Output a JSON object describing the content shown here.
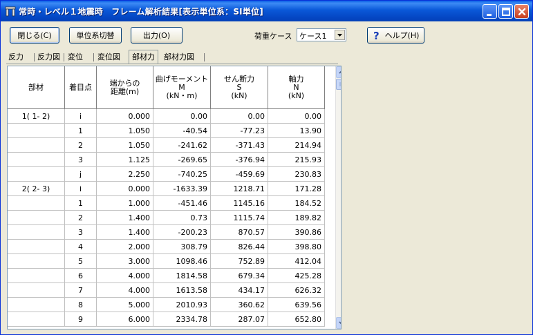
{
  "window": {
    "title": "常時・レベル１地震時　フレーム解析結果[表示単位系：SI単位]"
  },
  "toolbar": {
    "close_label": "閉じる(C)",
    "unit_label": "単位系切替",
    "output_label": "出力(O)",
    "load_case_label": "荷重ケース",
    "load_case_value": "ケース1",
    "help_label": "ヘルプ(H)"
  },
  "tabs": [
    "反力",
    "反力図",
    "変位",
    "変位図",
    "部材力",
    "部材力図"
  ],
  "active_tab": "部材力",
  "table": {
    "headers": [
      [
        "部材"
      ],
      [
        "着目点"
      ],
      [
        "端からの",
        "距離(m)"
      ],
      [
        "曲げモーメント",
        "M",
        "(kN・m)"
      ],
      [
        "せん断力",
        "S",
        "(kN)"
      ],
      [
        "軸力",
        "N",
        "(kN)"
      ]
    ],
    "rows": [
      [
        "1( 1- 2)",
        "i",
        "0.000",
        "0.00",
        "0.00",
        "0.00"
      ],
      [
        "",
        "1",
        "1.050",
        "-40.54",
        "-77.23",
        "13.90"
      ],
      [
        "",
        "2",
        "1.050",
        "-241.62",
        "-371.43",
        "214.94"
      ],
      [
        "",
        "3",
        "1.125",
        "-269.65",
        "-376.94",
        "215.93"
      ],
      [
        "",
        "j",
        "2.250",
        "-740.25",
        "-459.69",
        "230.83"
      ],
      [
        "2( 2- 3)",
        "i",
        "0.000",
        "-1633.39",
        "1218.71",
        "171.28"
      ],
      [
        "",
        "1",
        "1.000",
        "-451.46",
        "1145.16",
        "184.52"
      ],
      [
        "",
        "2",
        "1.400",
        "0.73",
        "1115.74",
        "189.82"
      ],
      [
        "",
        "3",
        "1.400",
        "-200.23",
        "870.57",
        "390.86"
      ],
      [
        "",
        "4",
        "2.000",
        "308.79",
        "826.44",
        "398.80"
      ],
      [
        "",
        "5",
        "3.000",
        "1098.46",
        "752.89",
        "412.04"
      ],
      [
        "",
        "6",
        "4.000",
        "1814.58",
        "679.34",
        "425.28"
      ],
      [
        "",
        "7",
        "4.000",
        "1613.58",
        "434.17",
        "626.32"
      ],
      [
        "",
        "8",
        "5.000",
        "2010.93",
        "360.62",
        "639.56"
      ],
      [
        "",
        "9",
        "6.000",
        "2334.78",
        "287.07",
        "652.80"
      ]
    ]
  }
}
